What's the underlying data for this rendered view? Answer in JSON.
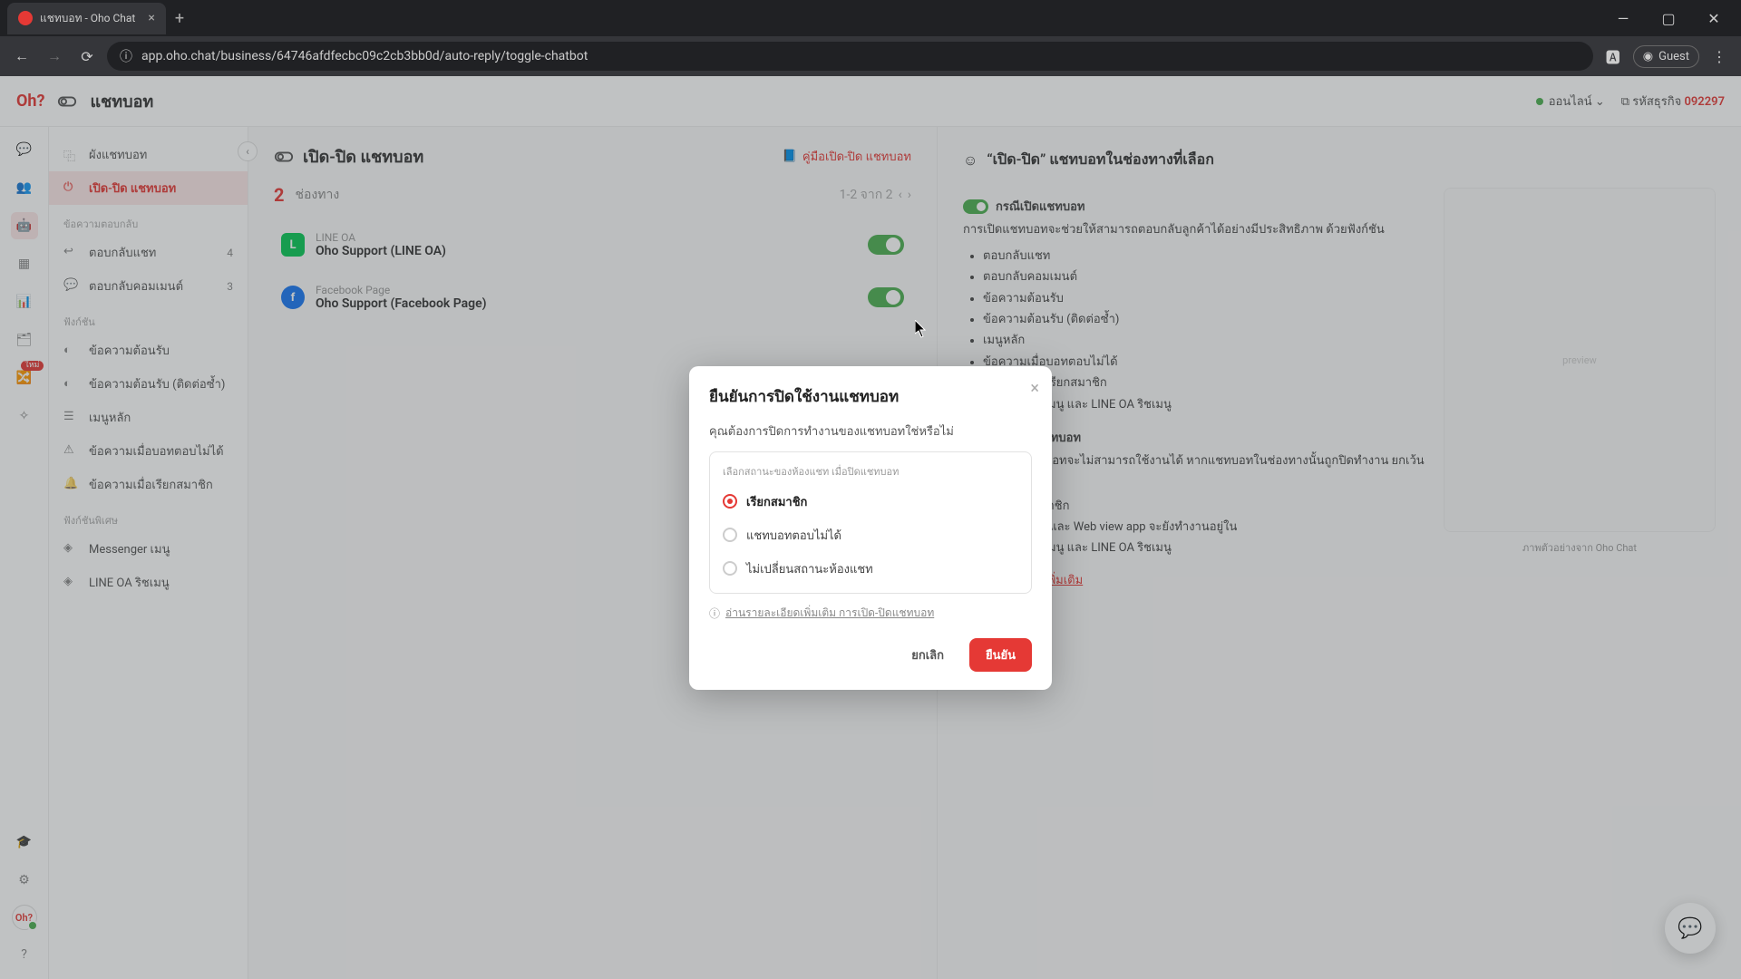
{
  "browser": {
    "tab_title": "แชทบอท - Oho Chat",
    "url": "app.oho.chat/business/64746afdfecbc09c2cb3bb0d/auto-reply/toggle-chatbot",
    "guest_label": "Guest"
  },
  "header": {
    "logo_text": "Oh?",
    "page_title": "แชทบอท",
    "status_label": "ออนไลน์",
    "biz_label": "รหัสธุรกิจ",
    "biz_code": "092297"
  },
  "sidebar": {
    "items": {
      "flowchart": "ผังแชทบอท",
      "toggle": "เปิด-ปิด แชทบอท"
    },
    "section_fallback": "ข้อความตอบกลับ",
    "fallback_chat": {
      "label": "ตอบกลับแชท",
      "count": "4"
    },
    "fallback_comment": {
      "label": "ตอบกลับคอมเมนต์",
      "count": "3"
    },
    "section_func": "ฟังก์ชัน",
    "funcs": {
      "welcome": "ข้อความต้อนรับ",
      "welcome_repeat": "ข้อความต้อนรับ (ติดต่อซ้ำ)",
      "main_menu": "เมนูหลัก",
      "no_reply": "ข้อความเมื่อบอทตอบไม่ได้",
      "call_staff": "ข้อความเมื่อเรียกสมาชิก"
    },
    "section_extra": "ฟังก์ชันพิเศษ",
    "extras": {
      "messenger": "Messenger เมนู",
      "line_rich": "LINE OA ริชเมนู"
    }
  },
  "panel": {
    "title": "เปิด-ปิด แชทบอท",
    "manual_link": "คู่มือเปิด-ปิด แชทบอท",
    "count_num": "2",
    "count_label": "ช่องทาง",
    "range": "1-2 จาก 2",
    "channels": [
      {
        "platform": "LINE OA",
        "name": "Oho Support (LINE OA)"
      },
      {
        "platform": "Facebook Page",
        "name": "Oho Support (Facebook Page)"
      }
    ]
  },
  "info": {
    "title": "“เปิด-ปิด” แชทบอทในช่องทางที่เลือก",
    "on_label": "กรณีเปิดแชทบอท",
    "on_desc": "การเปิดแชทบอทจะช่วยให้สามารถตอบกลับลูกค้าได้อย่างมีประสิทธิภาพ ด้วยฟังก์ชัน",
    "funcs": [
      "ตอบกลับแชท",
      "ตอบกลับคอมเมนต์",
      "ข้อความต้อนรับ",
      "ข้อความต้อนรับ (ติดต่อซ้ำ)",
      "เมนูหลัก",
      "ข้อความเมื่อบอทตอบไม่ได้",
      "ข้อความเมื่อเรียกสมาชิก",
      "Messenger เมนู และ LINE OA ริชเมนู"
    ],
    "off_label": "กรณีปิดแชทบอท",
    "off_desc": "ฟังก์ชันของแชทบอทจะไม่สามารถใช้งานได้ หากแชทบอทในช่องทางนั้นถูกปิดทำงาน ยกเว้นคำสั่ง",
    "off_items": [
      "ส่งแชทให้สมาชิก",
      "เปิดลิงก์ URL และ Web view app จะยังทำงานอยู่ใน",
      "Messenger เมนู และ LINE OA ริชเมนู"
    ],
    "more_link": "อ่านรายละเอียดเพิ่มเติม",
    "preview_caption": "ภาพตัวอย่างจาก Oho Chat"
  },
  "modal": {
    "title": "ยืนยันการปิดใช้งานแชทบอท",
    "desc": "คุณต้องการปิดการทำงานของแชทบอทใช่หรือไม่",
    "opt_head": "เลือกสถานะของห้องแชท เมื่อปิดแชทบอท",
    "options": [
      "เรียกสมาชิก",
      "แชทบอทตอบไม่ได้",
      "ไม่เปลี่ยนสถานะห้องแชท"
    ],
    "note_link": "อ่านรายละเอียดเพิ่มเติม การเปิด-ปิดแชทบอท",
    "cancel": "ยกเลิก",
    "confirm": "ยืนยัน"
  },
  "rail_avatar": "Oh?"
}
